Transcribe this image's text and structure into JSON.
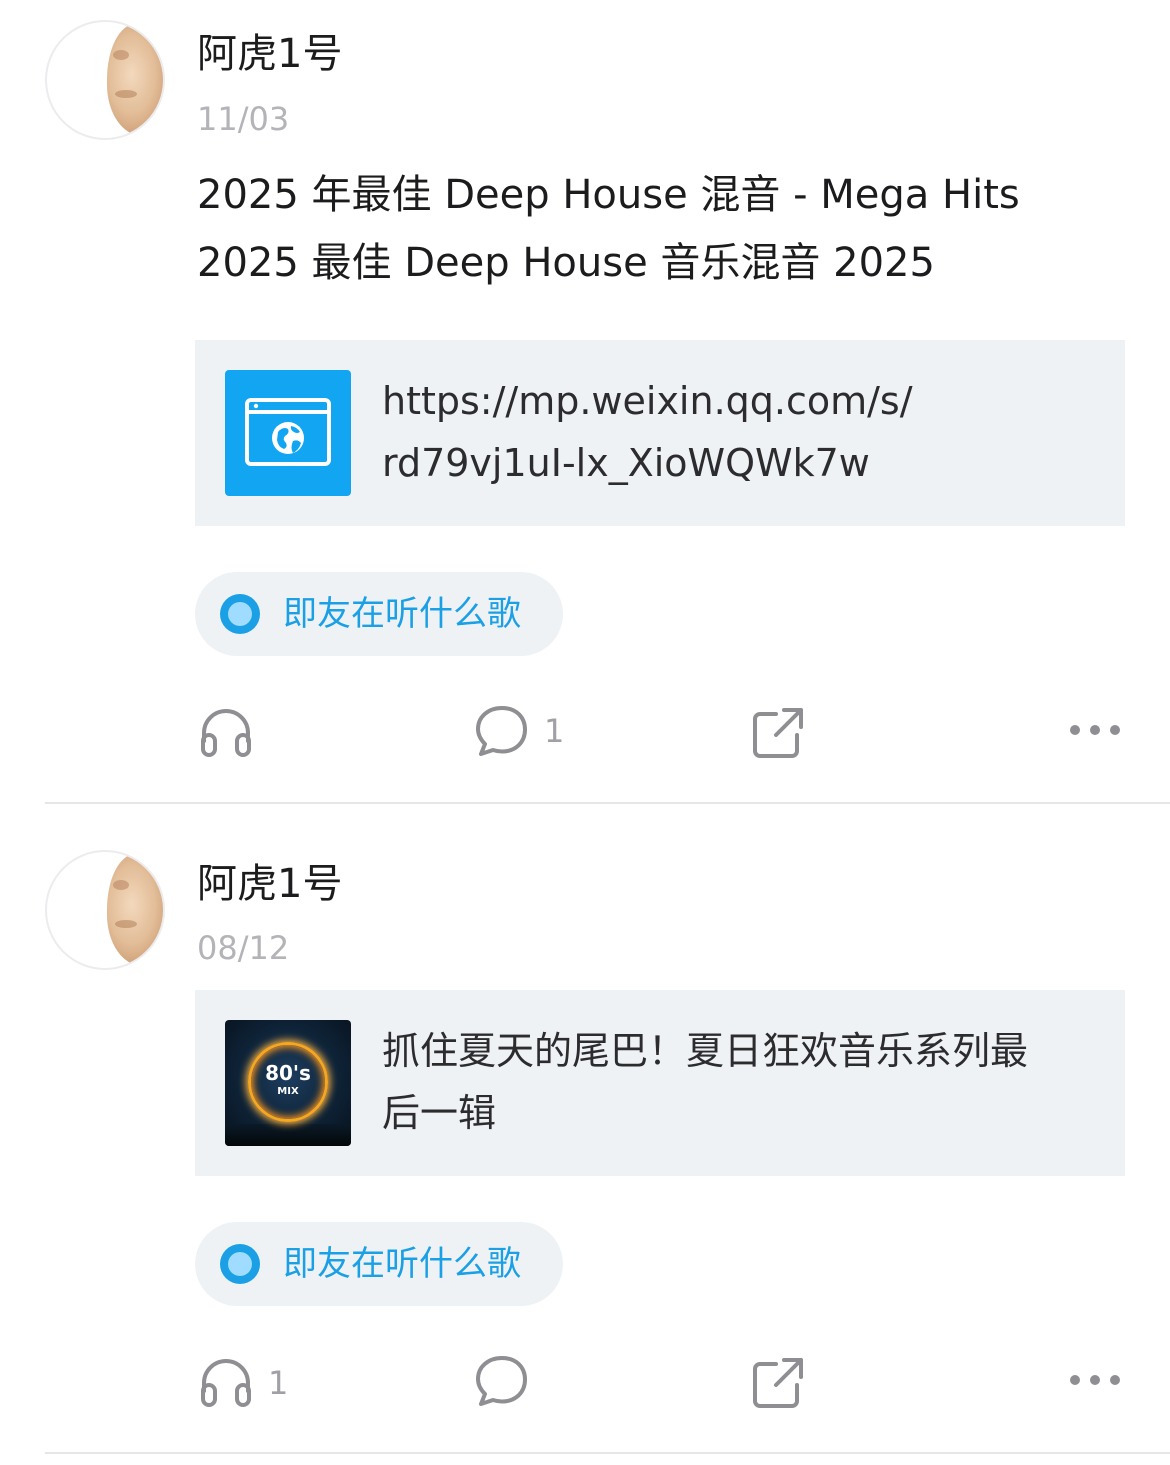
{
  "posts": [
    {
      "username": "阿虎1号",
      "date": "11/03",
      "text_line1": "2025 年最佳 Deep House 混音 - Mega Hits",
      "text_line2": "2025 最佳 Deep House 音乐混音 2025",
      "card": {
        "thumb_icon": "browser-globe-icon",
        "text_line1": "https://mp.weixin.qq.com/s/",
        "text_line2": "rd79vj1uI-lx_XioWQWk7w"
      },
      "topic": "即友在听什么歌",
      "actions": {
        "listen_count": "",
        "comment_count": "1",
        "share_count": ""
      }
    },
    {
      "username": "阿虎1号",
      "date": "08/12",
      "card": {
        "thumb_text_big": "80's",
        "thumb_text_small": "MIX",
        "text_line1": "抓住夏天的尾巴！夏日狂欢音乐系列最",
        "text_line2": "后一辑"
      },
      "topic": "即友在听什么歌",
      "actions": {
        "listen_count": "1",
        "comment_count": "",
        "share_count": ""
      }
    }
  ],
  "colors": {
    "accent": "#1ba0e6",
    "link_icon_bg": "#12a6f2",
    "card_bg": "#eff2f5",
    "muted_text": "#b3b3b8",
    "icon_gray": "#8e8e93"
  }
}
